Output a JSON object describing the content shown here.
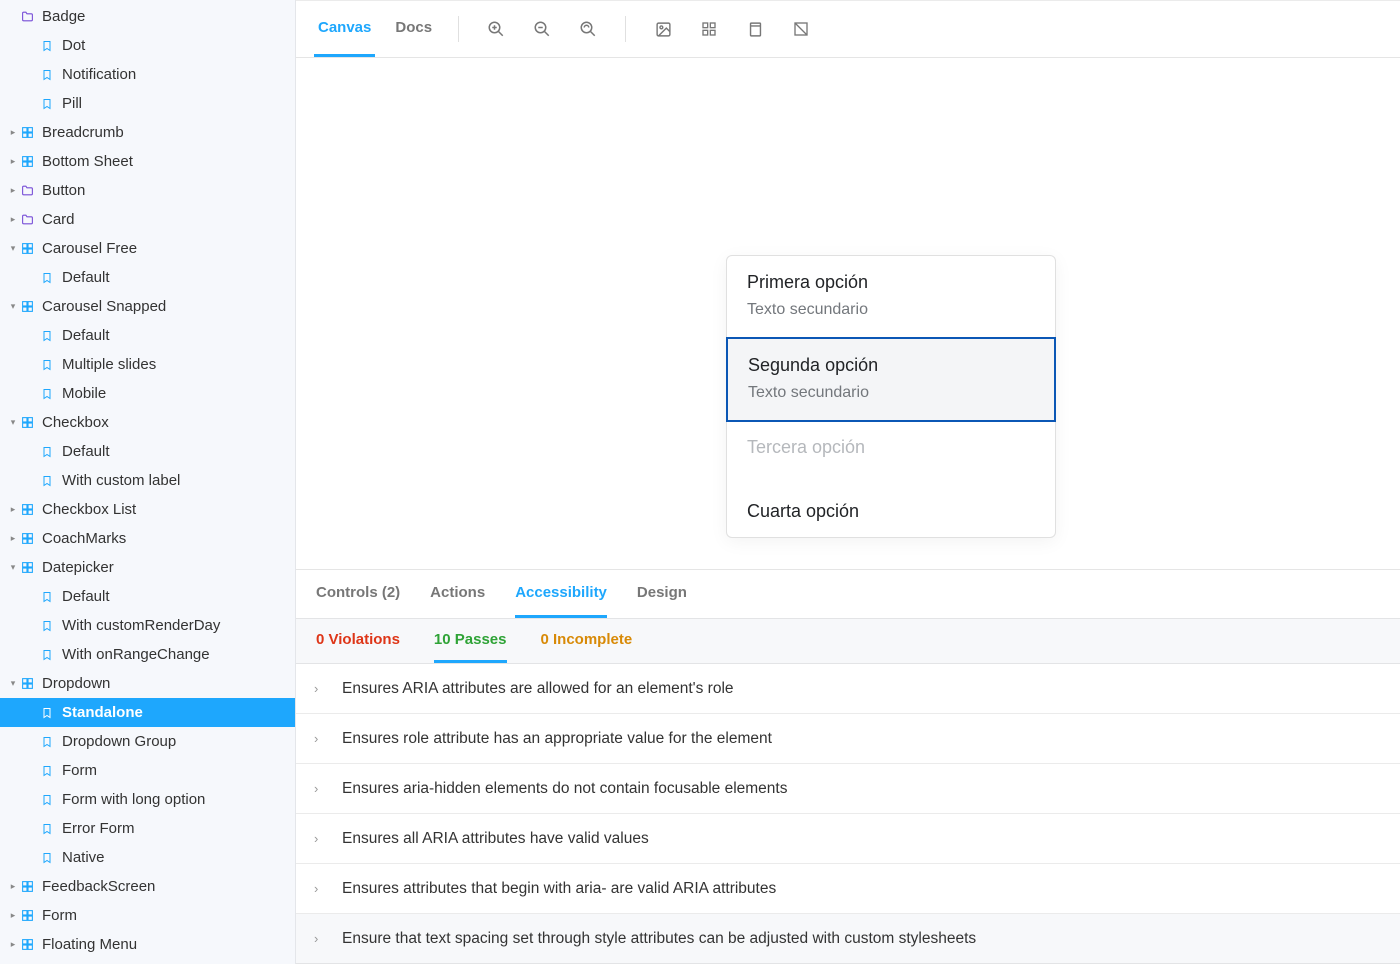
{
  "sidebar": {
    "items": [
      {
        "kind": "folder",
        "level": 1,
        "label": "Badge",
        "caret": ""
      },
      {
        "kind": "story",
        "level": 2,
        "label": "Dot"
      },
      {
        "kind": "story",
        "level": 2,
        "label": "Notification"
      },
      {
        "kind": "story",
        "level": 2,
        "label": "Pill"
      },
      {
        "kind": "group",
        "level": 1,
        "label": "Breadcrumb",
        "caret": "right"
      },
      {
        "kind": "group",
        "level": 1,
        "label": "Bottom Sheet",
        "caret": "right"
      },
      {
        "kind": "folder",
        "level": 1,
        "label": "Button",
        "caret": "right"
      },
      {
        "kind": "folder",
        "level": 1,
        "label": "Card",
        "caret": "right"
      },
      {
        "kind": "group",
        "level": 1,
        "label": "Carousel Free",
        "caret": "down"
      },
      {
        "kind": "story",
        "level": 2,
        "label": "Default"
      },
      {
        "kind": "group",
        "level": 1,
        "label": "Carousel Snapped",
        "caret": "down"
      },
      {
        "kind": "story",
        "level": 2,
        "label": "Default"
      },
      {
        "kind": "story",
        "level": 2,
        "label": "Multiple slides"
      },
      {
        "kind": "story",
        "level": 2,
        "label": "Mobile"
      },
      {
        "kind": "group",
        "level": 1,
        "label": "Checkbox",
        "caret": "down"
      },
      {
        "kind": "story",
        "level": 2,
        "label": "Default"
      },
      {
        "kind": "story",
        "level": 2,
        "label": "With custom label"
      },
      {
        "kind": "group",
        "level": 1,
        "label": "Checkbox List",
        "caret": "right"
      },
      {
        "kind": "group",
        "level": 1,
        "label": "CoachMarks",
        "caret": "right"
      },
      {
        "kind": "group",
        "level": 1,
        "label": "Datepicker",
        "caret": "down"
      },
      {
        "kind": "story",
        "level": 2,
        "label": "Default"
      },
      {
        "kind": "story",
        "level": 2,
        "label": "With customRenderDay"
      },
      {
        "kind": "story",
        "level": 2,
        "label": "With onRangeChange"
      },
      {
        "kind": "group",
        "level": 1,
        "label": "Dropdown",
        "caret": "down"
      },
      {
        "kind": "story",
        "level": 2,
        "label": "Standalone",
        "active": true
      },
      {
        "kind": "story",
        "level": 2,
        "label": "Dropdown Group"
      },
      {
        "kind": "story",
        "level": 2,
        "label": "Form"
      },
      {
        "kind": "story",
        "level": 2,
        "label": "Form with long option"
      },
      {
        "kind": "story",
        "level": 2,
        "label": "Error Form"
      },
      {
        "kind": "story",
        "level": 2,
        "label": "Native"
      },
      {
        "kind": "group",
        "level": 1,
        "label": "FeedbackScreen",
        "caret": "right"
      },
      {
        "kind": "group",
        "level": 1,
        "label": "Form",
        "caret": "right"
      },
      {
        "kind": "group",
        "level": 1,
        "label": "Floating Menu",
        "caret": "right"
      }
    ]
  },
  "toolbar": {
    "tabs": [
      "Canvas",
      "Docs"
    ]
  },
  "canvas": {
    "options": [
      {
        "title": "Primera opción",
        "sub": "Texto secundario",
        "state": "default"
      },
      {
        "title": "Segunda opción",
        "sub": "Texto secundario",
        "state": "selected"
      },
      {
        "title": "Tercera opción",
        "sub": "",
        "state": "disabled"
      },
      {
        "title": "Cuarta opción",
        "sub": "",
        "state": "default"
      }
    ]
  },
  "panel": {
    "tabs": [
      {
        "label": "Controls (2)"
      },
      {
        "label": "Actions"
      },
      {
        "label": "Accessibility",
        "active": true
      },
      {
        "label": "Design"
      }
    ],
    "subtabs": {
      "violations": "0 Violations",
      "passes": "10 Passes",
      "incomplete": "0 Incomplete"
    },
    "results": [
      "Ensures ARIA attributes are allowed for an element's role",
      "Ensures role attribute has an appropriate value for the element",
      "Ensures aria-hidden elements do not contain focusable elements",
      "Ensures all ARIA attributes have valid values",
      "Ensures attributes that begin with aria- are valid ARIA attributes",
      "Ensure that text spacing set through style attributes can be adjusted with custom stylesheets"
    ]
  }
}
